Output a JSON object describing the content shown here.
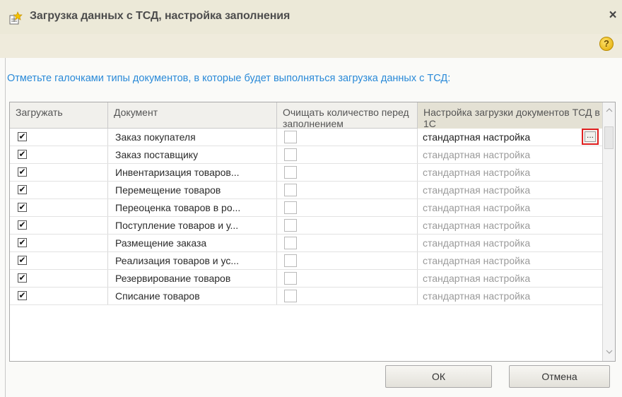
{
  "window": {
    "title": "Загрузка данных с ТСД, настройка заполнения",
    "close_label": "×",
    "help_label": "?"
  },
  "instruction": "Отметьте галочками типы документов, в которые будет выполняться загрузка данных с ТСД:",
  "table": {
    "columns": [
      "Загружать",
      "Документ",
      "Очищать количество перед заполнением",
      "Настройка загрузки документов ТСД в 1С"
    ],
    "rows": [
      {
        "load": true,
        "document": "Заказ покупателя",
        "clear": false,
        "setting": "стандартная настройка"
      },
      {
        "load": true,
        "document": "Заказ поставщику",
        "clear": false,
        "setting": "стандартная настройка"
      },
      {
        "load": true,
        "document": "Инвентаризация товаров...",
        "clear": false,
        "setting": "стандартная настройка"
      },
      {
        "load": true,
        "document": "Перемещение товаров",
        "clear": false,
        "setting": "стандартная настройка"
      },
      {
        "load": true,
        "document": "Переоценка товаров в ро...",
        "clear": false,
        "setting": "стандартная настройка"
      },
      {
        "load": true,
        "document": "Поступление товаров и у...",
        "clear": false,
        "setting": "стандартная настройка"
      },
      {
        "load": true,
        "document": "Размещение заказа",
        "clear": false,
        "setting": "стандартная настройка"
      },
      {
        "load": true,
        "document": "Реализация товаров и ус...",
        "clear": false,
        "setting": "стандартная настройка"
      },
      {
        "load": true,
        "document": "Резервирование товаров",
        "clear": false,
        "setting": "стандартная настройка"
      },
      {
        "load": true,
        "document": "Списание товаров",
        "clear": false,
        "setting": "стандартная настройка"
      }
    ],
    "select_button_label": "...",
    "check_mark": "✔"
  },
  "buttons": {
    "ok": "ОК",
    "cancel": "Отмена"
  },
  "colors": {
    "instruction_text": "#2a8ad8",
    "highlight_border": "#e02020",
    "title_bar": "#ece9d8"
  }
}
